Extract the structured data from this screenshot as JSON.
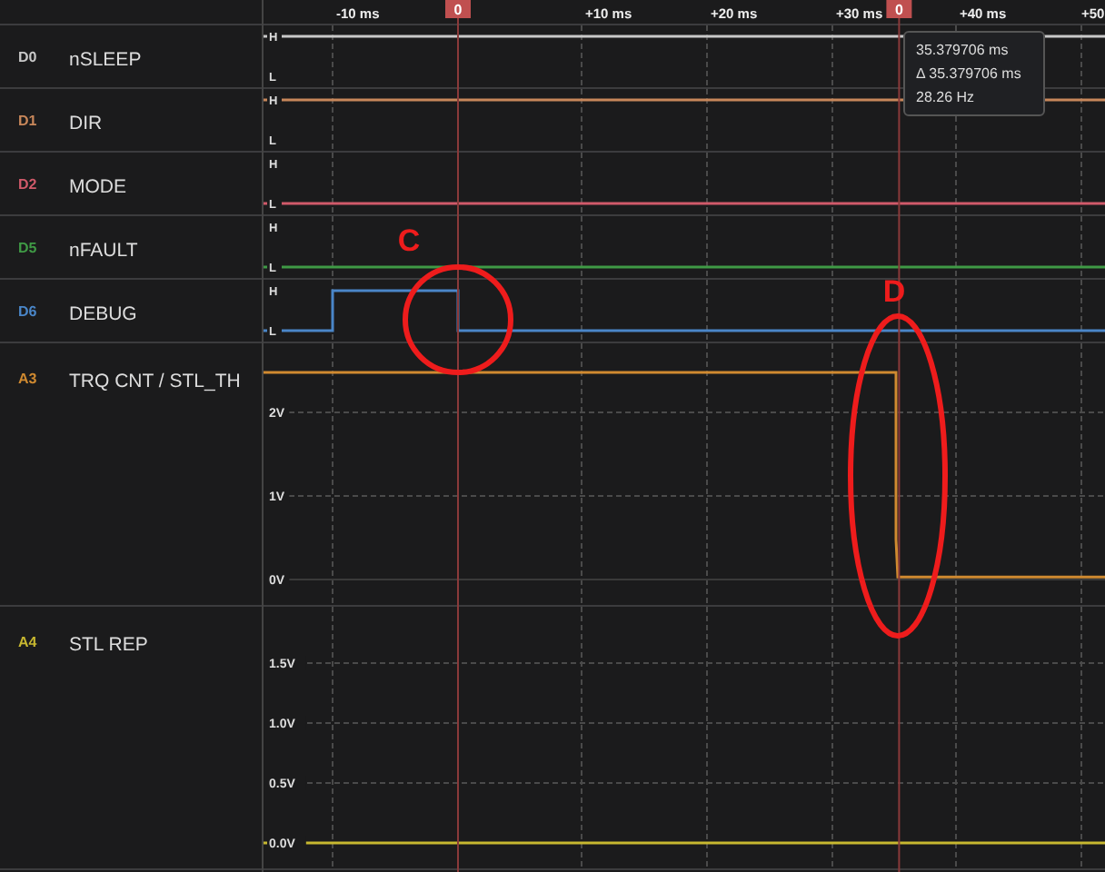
{
  "time_ruler": [
    "-10 ms",
    "+10 ms",
    "+20 ms",
    "+30 ms",
    "+40 ms",
    "+50"
  ],
  "cursors": [
    {
      "label": "0"
    },
    {
      "label": "0"
    }
  ],
  "channels": [
    {
      "kind": "high",
      "tag": "D0",
      "name": "nSLEEP",
      "color": "#c8c8c8",
      "level_labels": [
        "H",
        "L"
      ]
    },
    {
      "kind": "high",
      "tag": "D1",
      "name": "DIR",
      "color": "#c8875a",
      "level_labels": [
        "H",
        "L"
      ]
    },
    {
      "kind": "low",
      "tag": "D2",
      "name": "MODE",
      "color": "#d05a6a",
      "level_labels": [
        "H",
        "L"
      ]
    },
    {
      "kind": "low",
      "tag": "D5",
      "name": "nFAULT",
      "color": "#3f9a45",
      "level_labels": [
        "H",
        "L"
      ]
    },
    {
      "kind": "pulse",
      "tag": "D6",
      "name": "DEBUG",
      "color": "#4a86c8",
      "level_labels": [
        "H",
        "L"
      ]
    },
    {
      "kind": "step",
      "tag": "A3",
      "name": "TRQ CNT / STL_TH",
      "color": "#d08a30",
      "scale_labels": [
        "2V",
        "1V",
        "0V"
      ]
    },
    {
      "kind": "flat",
      "tag": "A4",
      "name": "STL REP",
      "color": "#c8b830",
      "scale_labels": [
        "1.5V",
        "1.0V",
        "0.5V",
        "0.0V"
      ]
    }
  ],
  "cursor_tooltip": [
    "35.379706 ms",
    "Δ 35.379706 ms",
    "28.26 Hz"
  ],
  "markups": [
    {
      "label": "C"
    },
    {
      "label": "D"
    }
  ]
}
